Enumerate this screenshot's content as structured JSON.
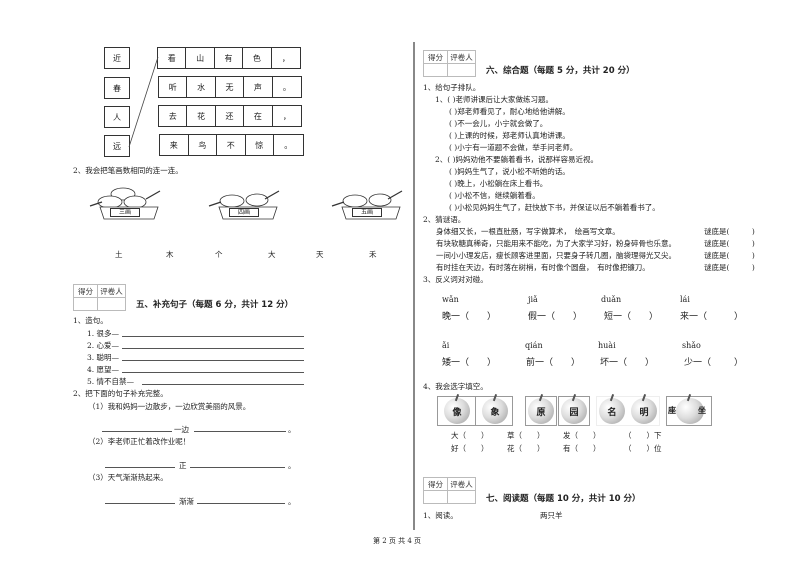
{
  "matching_poem": {
    "left_chars": [
      "近",
      "春",
      "人",
      "远"
    ],
    "rows": [
      [
        "看",
        "山",
        "有",
        "色",
        "，"
      ],
      [
        "听",
        "水",
        "无",
        "声",
        "。"
      ],
      [
        "去",
        "花",
        "还",
        "在",
        "，"
      ],
      [
        "来",
        "鸟",
        "不",
        "惊",
        "。"
      ]
    ]
  },
  "q2_stroke": {
    "prompt": "2、我会把笔画数相同的连一连。",
    "pots": [
      "三画",
      "四画",
      "五画"
    ],
    "chars": [
      "土",
      "木",
      "个",
      "大",
      "天",
      "禾"
    ]
  },
  "score_box": {
    "col1": "得分",
    "col2": "评卷人"
  },
  "section5": {
    "title": "五、补充句子（每题 6 分，共计 12 分）",
    "q1_label": "1、造句。",
    "q1_items": [
      "1. 很多—",
      "2. 心爱—",
      "3. 聪明—",
      "4. 愿望—",
      "5. 情不自禁—"
    ],
    "q2_label": "2、把下面的句子补充完整。",
    "q2_items": [
      {
        "example": "（1）我和妈妈一边散步，一边欣赏美丽的风景。",
        "mid": "一边",
        "end": "。"
      },
      {
        "example": "（2）李老师正忙着改作业呢！",
        "mid": "正",
        "end": "。"
      },
      {
        "example": "（3）天气渐渐热起来。",
        "mid": "渐渐",
        "end": "。"
      }
    ]
  },
  "section6": {
    "title": "六、综合题（每题 5 分，共计 20 分）",
    "q1_label": "1、给句子排队。",
    "group1": [
      "1、(    )老师讲课后让大家做练习题。",
      "(    )郑老师看见了，耐心地给他讲解。",
      "(    )不一会儿，小宁就会做了。",
      "(    )上课的时候，郑老师认真地讲课。",
      "(    )小宁有一道题不会做，举手问老师。"
    ],
    "group2": [
      "2、(    )妈妈劝他不要躺着看书，说那样容易近视。",
      "(    )妈妈生气了，说小松不听她的话。",
      "(    )晚上，小松躺在床上看书。",
      "(    )小松不信，继续躺着看。",
      "(    )小松见妈妈生气了，赶快放下书，并保证以后不躺着看书了。"
    ],
    "q2_label": "2、猜谜语。",
    "riddles": [
      "身体细又长，一根直肚肠，写字做算术，　绘画写文章。",
      "有块软糖真稀奇，只能用来不能吃，为了大家学习好，粉身碎骨也乐意。",
      "一间小小理发店，瘦长顾客进里面，只要身子转几圈，脑袋理得光又尖。",
      "有时挂在天边，有时落在树梢，有时像个圆盘，　有时像把镰刀。"
    ],
    "riddle_answer": "谜底是(　　　)",
    "q3_label": "3、反义词对对碰。",
    "antonyms_row1": [
      {
        "pinyin": "wǎn",
        "word": "晚一（　　）"
      },
      {
        "pinyin": "jiǎ",
        "word": "假一（　　）"
      },
      {
        "pinyin": "duǎn",
        "word": "短一（　　）"
      },
      {
        "pinyin": "lái",
        "word": "来一（"
      }
    ],
    "antonyms_row2": [
      {
        "pinyin": "ǎi",
        "word": "矮一（　　）"
      },
      {
        "pinyin": "qián",
        "word": "前一（　　）"
      },
      {
        "pinyin": "huài",
        "word": "坏一（　　）"
      },
      {
        "pinyin": "shǎo",
        "word": "少一（"
      }
    ],
    "q4_label": "4、我会选字填空。",
    "apple_chars": [
      "像",
      "象",
      "原",
      "园",
      "名",
      "明",
      "座",
      "坐"
    ],
    "fill_row1": [
      "大（　　）",
      "草（　　）",
      "发（　　）",
      "（　　）下"
    ],
    "fill_row2": [
      "好（　　）",
      "花（　　）",
      "有（　　）",
      "（　　）位"
    ]
  },
  "section7": {
    "title": "七、阅读题（每题 10 分，共计 10 分）",
    "q1_label": "1、阅读。",
    "passage_title": "两只羊"
  },
  "footer": {
    "page_text": "第 2 页 共 4 页"
  }
}
